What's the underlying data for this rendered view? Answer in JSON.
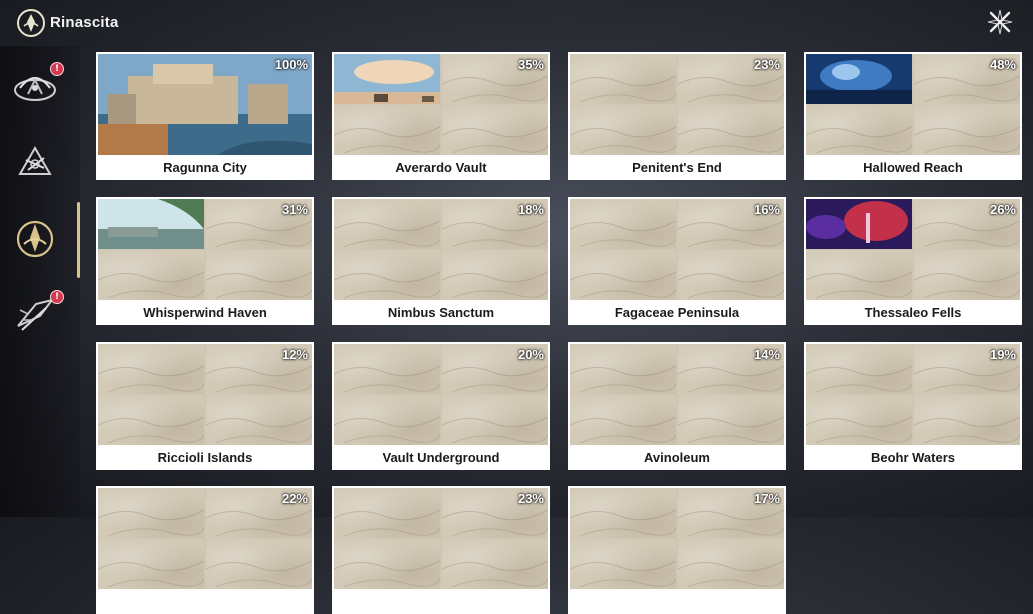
{
  "header": {
    "title": "Rinascita",
    "region_icon": "rinascita-emblem-icon",
    "close_icon": "close-x-icon"
  },
  "sidebar": {
    "items": [
      {
        "icon": "dragon-crest-icon",
        "badge": "!",
        "selected": false
      },
      {
        "icon": "shard-crest-icon",
        "badge": "",
        "selected": false
      },
      {
        "icon": "rinascita-crest-icon",
        "badge": "",
        "selected": true
      },
      {
        "icon": "wing-blade-icon",
        "badge": "!",
        "selected": false
      }
    ]
  },
  "locations": [
    {
      "name": "Ragunna City",
      "progress": "100%",
      "revealed": 4
    },
    {
      "name": "Averardo Vault",
      "progress": "35%",
      "revealed": 1
    },
    {
      "name": "Penitent's End",
      "progress": "23%",
      "revealed": 0
    },
    {
      "name": "Hallowed Reach",
      "progress": "48%",
      "revealed": 1
    },
    {
      "name": "Whisperwind Haven",
      "progress": "31%",
      "revealed": 1
    },
    {
      "name": "Nimbus Sanctum",
      "progress": "18%",
      "revealed": 0
    },
    {
      "name": "Fagaceae Peninsula",
      "progress": "16%",
      "revealed": 0
    },
    {
      "name": "Thessaleo Fells",
      "progress": "26%",
      "revealed": 1
    },
    {
      "name": "Riccioli Islands",
      "progress": "12%",
      "revealed": 0
    },
    {
      "name": "Vault Underground",
      "progress": "20%",
      "revealed": 0
    },
    {
      "name": "Avinoleum",
      "progress": "14%",
      "revealed": 0
    },
    {
      "name": "Beohr Waters",
      "progress": "19%",
      "revealed": 0
    },
    {
      "name": "",
      "progress": "22%",
      "revealed": 0
    },
    {
      "name": "",
      "progress": "23%",
      "revealed": 0
    },
    {
      "name": "",
      "progress": "17%",
      "revealed": 0
    }
  ],
  "colors": {
    "accent": "#d9c38a",
    "badge": "#d23a4f",
    "card_bg": "#ffffff",
    "parchment": "#d2c9b6"
  }
}
